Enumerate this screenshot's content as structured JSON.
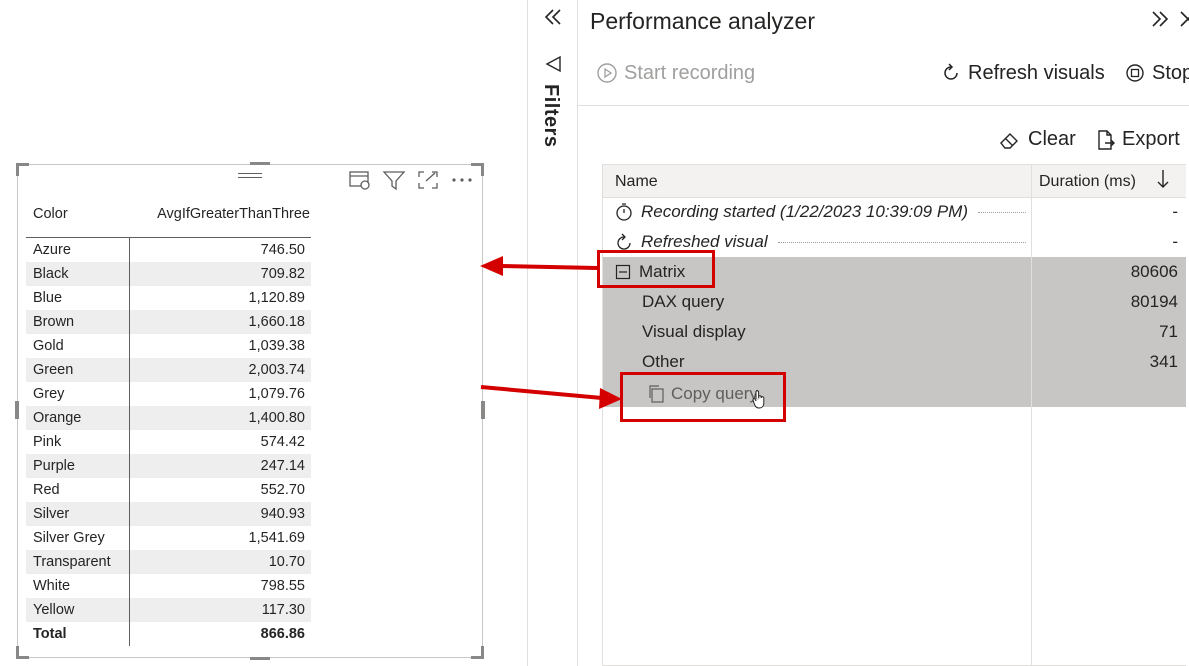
{
  "matrix": {
    "headers": {
      "col1": "Color",
      "col2": "AvgIfGreaterThanThree"
    },
    "rows": [
      {
        "name": "Azure",
        "value": "746.50"
      },
      {
        "name": "Black",
        "value": "709.82"
      },
      {
        "name": "Blue",
        "value": "1,120.89"
      },
      {
        "name": "Brown",
        "value": "1,660.18"
      },
      {
        "name": "Gold",
        "value": "1,039.38"
      },
      {
        "name": "Green",
        "value": "2,003.74"
      },
      {
        "name": "Grey",
        "value": "1,079.76"
      },
      {
        "name": "Orange",
        "value": "1,400.80"
      },
      {
        "name": "Pink",
        "value": "574.42"
      },
      {
        "name": "Purple",
        "value": "247.14"
      },
      {
        "name": "Red",
        "value": "552.70"
      },
      {
        "name": "Silver",
        "value": "940.93"
      },
      {
        "name": "Silver Grey",
        "value": "1,541.69"
      },
      {
        "name": "Transparent",
        "value": "10.70"
      },
      {
        "name": "White",
        "value": "798.55"
      },
      {
        "name": "Yellow",
        "value": "117.30"
      }
    ],
    "total": {
      "name": "Total",
      "value": "866.86"
    }
  },
  "filters": {
    "label": "Filters"
  },
  "analyzer": {
    "title": "Performance analyzer",
    "start_recording": "Start recording",
    "refresh_visuals": "Refresh visuals",
    "stop": "Stop",
    "clear": "Clear",
    "export": "Export",
    "grid": {
      "col_name": "Name",
      "col_duration": "Duration (ms)",
      "rows": [
        {
          "name": "Recording started (1/22/2023 10:39:09 PM)",
          "duration": "-"
        },
        {
          "name": "Refreshed visual",
          "duration": "-"
        },
        {
          "name": "Matrix",
          "duration": "80606"
        },
        {
          "name": "DAX query",
          "duration": "80194"
        },
        {
          "name": "Visual display",
          "duration": "71"
        },
        {
          "name": "Other",
          "duration": "341"
        }
      ],
      "copy_query": "Copy query"
    }
  },
  "colors": {
    "highlight": "#d40000",
    "selection": "#c8c6c4"
  }
}
